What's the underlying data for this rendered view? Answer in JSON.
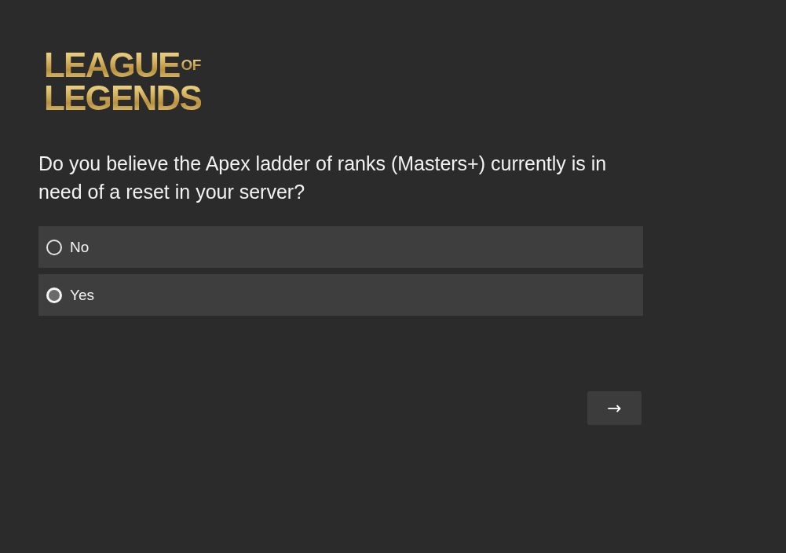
{
  "logo": {
    "line_1": "LEAGUE",
    "small": "OF",
    "line_2": "LEGENDS"
  },
  "question": "Do you believe the Apex ladder of ranks (Masters+) currently is in need of a reset in your server?",
  "options": [
    {
      "label": "No",
      "selected": false
    },
    {
      "label": "Yes",
      "selected": true
    }
  ],
  "next_button": {
    "label": "→"
  }
}
